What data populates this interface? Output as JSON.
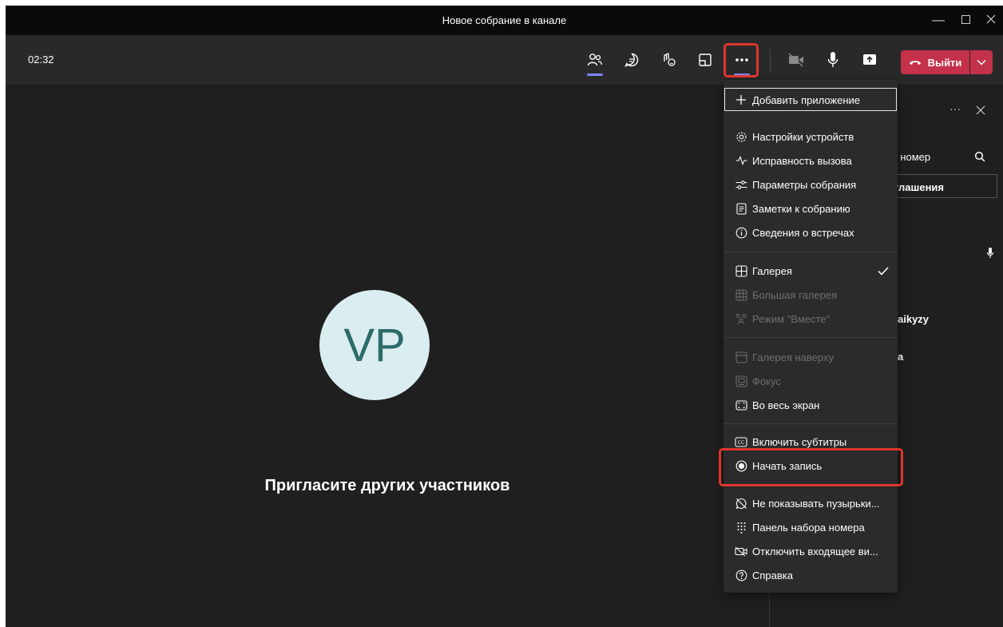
{
  "window": {
    "title": "Новое собрание в канале"
  },
  "toolbar": {
    "timer": "02:32",
    "leave_label": "Выйти"
  },
  "stage": {
    "avatar_initials": "VP",
    "invite_text": "Пригласите других участников"
  },
  "panel": {
    "search_text": "ать номер",
    "invite_button_text": "риглашения",
    "participant_1": "aikyzy",
    "participant_2": "a"
  },
  "menu": {
    "add_app": "Добавить приложение",
    "device_settings": "Настройки устройств",
    "call_health": "Исправность вызова",
    "meeting_options": "Параметры собрания",
    "meeting_notes": "Заметки к собранию",
    "meeting_info": "Сведения о встречах",
    "gallery": "Галерея",
    "large_gallery": "Большая галерея",
    "together_mode": "Режим \"Вместе\"",
    "gallery_top": "Галерея наверху",
    "focus": "Фокус",
    "fullscreen": "Во весь экран",
    "captions": "Включить субтитры",
    "start_recording": "Начать запись",
    "hide_bubbles": "Не показывать пузырьки...",
    "dialpad": "Панель набора номера",
    "disable_incoming_video": "Отключить входящее ви...",
    "help": "Справка"
  },
  "colors": {
    "accent": "#7f85f5",
    "leave": "#c4314b",
    "highlight": "#e0362c",
    "avatar_bg": "#daeef1"
  }
}
